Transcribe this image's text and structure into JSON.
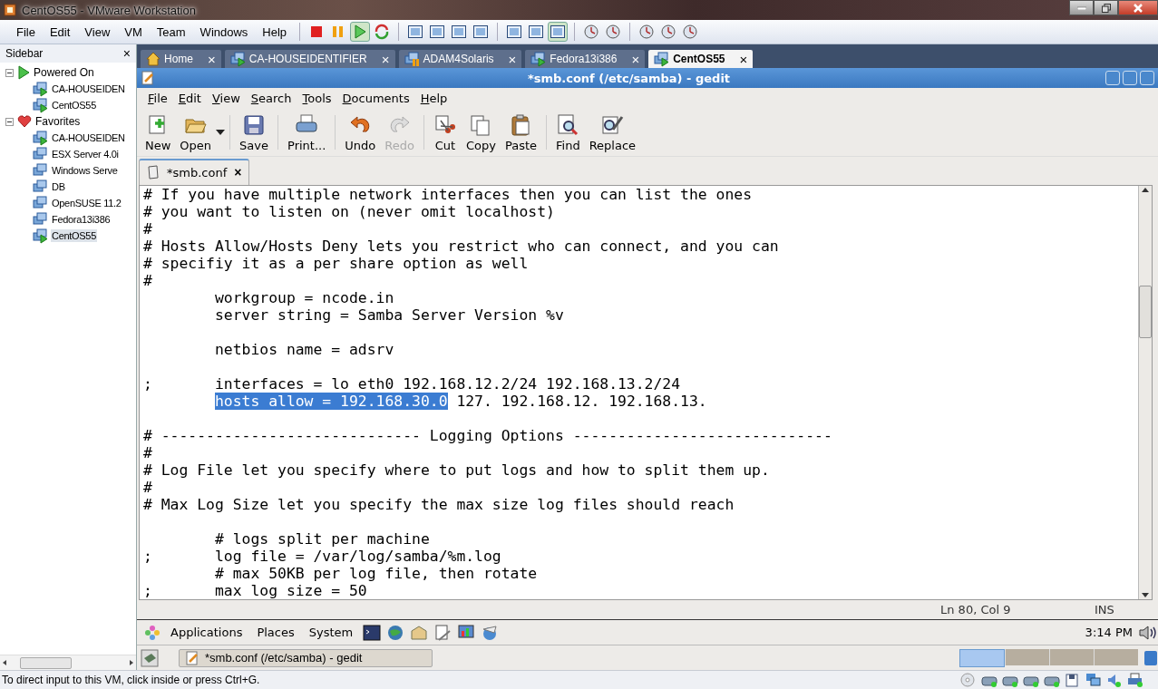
{
  "window": {
    "title": "CentOS55 - VMware Workstation"
  },
  "menu": [
    "File",
    "Edit",
    "View",
    "VM",
    "Team",
    "Windows",
    "Help"
  ],
  "toolbar": [
    {
      "kind": "stop",
      "pressed": false
    },
    {
      "kind": "pause",
      "pressed": false
    },
    {
      "kind": "play",
      "pressed": true
    },
    {
      "kind": "reset",
      "pressed": false
    },
    {
      "kind": "sep"
    },
    {
      "kind": "view",
      "pressed": false
    },
    {
      "kind": "view",
      "pressed": false
    },
    {
      "kind": "view",
      "pressed": false
    },
    {
      "kind": "view",
      "pressed": false
    },
    {
      "kind": "sep"
    },
    {
      "kind": "view",
      "pressed": false
    },
    {
      "kind": "view",
      "pressed": false
    },
    {
      "kind": "view",
      "pressed": true
    },
    {
      "kind": "sep"
    },
    {
      "kind": "snapshot",
      "pressed": false
    },
    {
      "kind": "snapshot",
      "pressed": false
    },
    {
      "kind": "sep"
    },
    {
      "kind": "snapshot",
      "pressed": false
    },
    {
      "kind": "snapshot",
      "pressed": false
    },
    {
      "kind": "snapshot",
      "pressed": false
    }
  ],
  "sidebar": {
    "title": "Sidebar",
    "close": "×",
    "items": [
      {
        "label": "Powered On",
        "kind": "group-on",
        "expanded": true,
        "children": [
          {
            "label": "CA-HOUSEIDEN",
            "running": true,
            "selected": false
          },
          {
            "label": "CentOS55",
            "running": true,
            "selected": false
          }
        ]
      },
      {
        "label": "Favorites",
        "kind": "group-fav",
        "expanded": true,
        "children": [
          {
            "label": "CA-HOUSEIDEN",
            "running": true,
            "selected": false
          },
          {
            "label": "ESX Server 4.0i",
            "running": false,
            "selected": false
          },
          {
            "label": "Windows Serve",
            "running": false,
            "selected": false
          },
          {
            "label": "DB",
            "running": false,
            "selected": false
          },
          {
            "label": "OpenSUSE 11.2",
            "running": false,
            "selected": false
          },
          {
            "label": "Fedora13i386",
            "running": false,
            "selected": false
          },
          {
            "label": "CentOS55",
            "running": true,
            "selected": true
          }
        ]
      }
    ]
  },
  "vm_tabs": [
    {
      "label": "Home",
      "kind": "home",
      "selected": false,
      "close": "×"
    },
    {
      "label": "CA-HOUSEIDENTIFIER",
      "kind": "vm",
      "selected": false,
      "close": "×"
    },
    {
      "label": "ADAM4Solaris",
      "kind": "vm-paused",
      "selected": false,
      "close": "×"
    },
    {
      "label": "Fedora13i386",
      "kind": "vm",
      "selected": false,
      "close": "×"
    },
    {
      "label": "CentOS55",
      "kind": "vm",
      "selected": true,
      "close": "×"
    }
  ],
  "gedit": {
    "title": "*smb.conf (/etc/samba) - gedit",
    "menu": [
      "File",
      "Edit",
      "View",
      "Search",
      "Tools",
      "Documents",
      "Help"
    ],
    "toolbar": [
      {
        "kind": "new",
        "label": "New",
        "disabled": false
      },
      {
        "kind": "open",
        "label": "Open",
        "disabled": false
      },
      {
        "kind": "sep"
      },
      {
        "kind": "save",
        "label": "Save",
        "disabled": false
      },
      {
        "kind": "sep"
      },
      {
        "kind": "print",
        "label": "Print...",
        "disabled": false
      },
      {
        "kind": "sep"
      },
      {
        "kind": "undo",
        "label": "Undo",
        "disabled": false
      },
      {
        "kind": "redo",
        "label": "Redo",
        "disabled": true
      },
      {
        "kind": "sep"
      },
      {
        "kind": "cut",
        "label": "Cut",
        "disabled": false
      },
      {
        "kind": "copy",
        "label": "Copy",
        "disabled": false
      },
      {
        "kind": "paste",
        "label": "Paste",
        "disabled": false
      },
      {
        "kind": "sep"
      },
      {
        "kind": "find",
        "label": "Find",
        "disabled": false
      },
      {
        "kind": "replace",
        "label": "Replace",
        "disabled": false
      }
    ],
    "tab": {
      "label": "*smb.conf",
      "close": "×"
    },
    "lines": [
      {
        "kind": "code",
        "text": "# If you have multiple network interfaces then you can list the ones"
      },
      {
        "kind": "code",
        "text": "# you want to listen on (never omit localhost)"
      },
      {
        "kind": "code",
        "text": "#"
      },
      {
        "kind": "code",
        "text": "# Hosts Allow/Hosts Deny lets you restrict who can connect, and you can"
      },
      {
        "kind": "code",
        "text": "# specifiy it as a per share option as well"
      },
      {
        "kind": "code",
        "text": "#"
      },
      {
        "kind": "code",
        "text": "        workgroup = ncode.in"
      },
      {
        "kind": "code",
        "text": "        server string = Samba Server Version %v"
      },
      {
        "kind": "blank"
      },
      {
        "kind": "code",
        "text": "        netbios name = adsrv"
      },
      {
        "kind": "blank"
      },
      {
        "kind": "code",
        "text": ";       interfaces = lo eth0 192.168.12.2/24 192.168.13.2/24"
      },
      {
        "kind": "selected",
        "selection": "hosts allow = 192.168.30.0",
        "after": " 127. 192.168.12. 192.168.13."
      },
      {
        "kind": "blank"
      },
      {
        "kind": "code",
        "text": "# ----------------------------- Logging Options -----------------------------"
      },
      {
        "kind": "code",
        "text": "#"
      },
      {
        "kind": "code",
        "text": "# Log File let you specify where to put logs and how to split them up."
      },
      {
        "kind": "code",
        "text": "#"
      },
      {
        "kind": "code",
        "text": "# Max Log Size let you specify the max size log files should reach"
      },
      {
        "kind": "blank"
      },
      {
        "kind": "code",
        "text": "        # logs split per machine"
      },
      {
        "kind": "code",
        "text": ";       log file = /var/log/samba/%m.log"
      },
      {
        "kind": "code",
        "text": "        # max 50KB per log file, then rotate"
      },
      {
        "kind": "code",
        "text": ";       max log size = 50"
      }
    ],
    "status": {
      "position": "Ln 80, Col 9",
      "mode": "INS"
    }
  },
  "panel": {
    "menus": [
      "Applications",
      "Places",
      "System"
    ],
    "launchers": [
      {
        "kind": "terminal"
      },
      {
        "kind": "globe"
      },
      {
        "kind": "mail"
      },
      {
        "kind": "edit"
      },
      {
        "kind": "monitor"
      },
      {
        "kind": "network"
      }
    ],
    "clock": "3:14 PM"
  },
  "taskbar": {
    "window": "*smb.conf (/etc/samba) - gedit",
    "workspaces": [
      {
        "selected": true
      },
      {
        "selected": false
      },
      {
        "selected": false
      },
      {
        "selected": false
      }
    ]
  },
  "status_bar": {
    "text": "To direct input to this VM, click inside or press Ctrl+G.",
    "devices": [
      {
        "kind": "cd"
      },
      {
        "kind": "disk"
      },
      {
        "kind": "disk"
      },
      {
        "kind": "disk"
      },
      {
        "kind": "disk"
      },
      {
        "kind": "floppy"
      },
      {
        "kind": "network"
      },
      {
        "kind": "sound"
      },
      {
        "kind": "printer"
      }
    ]
  }
}
